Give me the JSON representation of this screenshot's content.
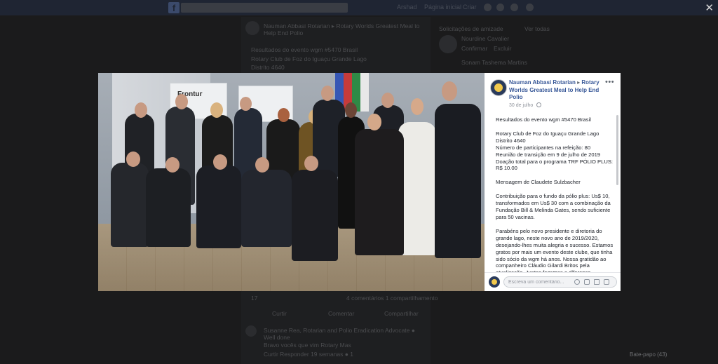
{
  "background": {
    "nav_items": [
      "Arshad",
      "Página inicial",
      "Criar"
    ],
    "background_post": {
      "author_line": "Nauman Abbasi Rotarian ▸ Rotary Worlds Greatest Meal to Help End Polio",
      "lines": [
        "Resultados do evento wgm #5470 Brasil",
        "Rotary Club de Foz do Iguaçu Grande Lago",
        "Distrito 4640"
      ],
      "actions": [
        "Curtir",
        "Comentar",
        "Compartilhar"
      ],
      "reactions_count": "17",
      "stats": "4 comentários  1 compartilhamento",
      "comment_author": "Susanne Rea, Rotarian and Polio Eradication Advocate ● Well done",
      "comment_text": "Bravo vocês que vim Rotary Mas",
      "comment_meta": "Curtir  Responder  19 semanas  ● 1"
    },
    "suggestions_title": "Solicitações de amizade",
    "suggestions_link": "Ver todas",
    "suggestion_names": [
      "Nourdine Cavalier",
      "Sonam Tashema Martins"
    ],
    "suggestion_actions": [
      "Confirmar",
      "Excluir"
    ],
    "chat_label": "Bate-papo (43)"
  },
  "photo": {
    "banner_text": "Frontur"
  },
  "post": {
    "author": "Nauman Abbasi Rotarian",
    "group": "Rotary Worlds Greatest Meal to Help End Polio",
    "date": "30 de julho",
    "paragraphs": [
      "Resultados do evento wgm #5470 Brasil",
      "Rotary Club de Foz do Iguaçu Grande Lago\nDistrito 4640\nNúmero de participantes na refeição: 80\nReunião de transição em 9 de julho de 2019\nDoação total para o programa TRF PÓLIO PLUS: R$ 10.00",
      "Mensagem de Claudete Sulzbacher",
      "Contribuição para o fundo da pólio plus: Us$ 10, transformados em Us$ 30 com a combinação da Fundação Bill & Melinda Gates, sendo suficiente para 50 vacinas.",
      "Parabéns pelo novo presidente e diretoria do grande lago, neste novo ano de 2019/2020, desejando-lhes muita alegria e sucesso. Estamos gratos por mais um evento deste clube, que tinha sido sócio da wgm há anos. Nossa gratidão ao companheiro Cláudio Gilardi Britos pela atualização. Juntos fazemos a diferença."
    ],
    "comment_placeholder": "Escreva um comentário..."
  },
  "colors": {
    "link": "#385898",
    "overlay": "#1b1b1c",
    "panel": "#ffffff"
  },
  "icons": [
    "close-icon",
    "more-options-icon",
    "globe-icon",
    "emoji-icon",
    "camera-icon",
    "gif-icon",
    "sticker-icon"
  ]
}
